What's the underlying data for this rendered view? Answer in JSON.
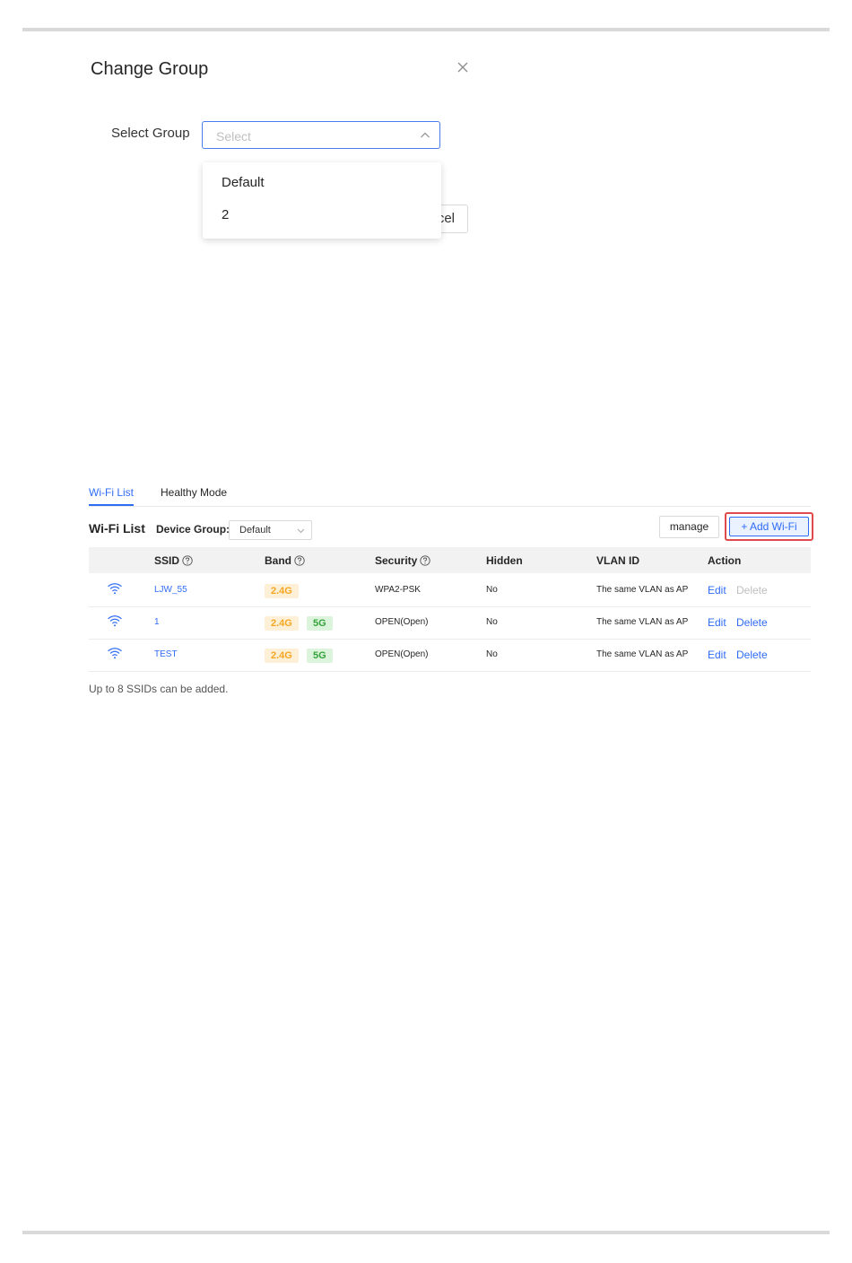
{
  "dialog": {
    "title": "Change Group",
    "select_label": "Select Group",
    "select_placeholder": "Select",
    "options": [
      "Default",
      "2"
    ],
    "cancel_label": "Cancel"
  },
  "tabs": [
    {
      "label": "Wi-Fi List",
      "active": true
    },
    {
      "label": "Healthy Mode",
      "active": false
    }
  ],
  "wifi_list": {
    "title": "Wi-Fi List",
    "device_group_label": "Device Group:",
    "device_group_value": "Default",
    "manage_label": "manage",
    "add_label": "+ Add Wi-Fi",
    "columns": [
      "SSID",
      "Band",
      "Security",
      "Hidden",
      "VLAN ID",
      "Action"
    ],
    "rows": [
      {
        "ssid": "LJW_55",
        "band24": "2.4G",
        "band5": "",
        "security": "WPA2-PSK",
        "hidden": "No",
        "vlan": "The same VLAN as AP",
        "edit": "Edit",
        "delete": "Delete",
        "delete_enabled": false
      },
      {
        "ssid": "1",
        "band24": "2.4G",
        "band5": "5G",
        "security": "OPEN(Open)",
        "hidden": "No",
        "vlan": "The same VLAN as AP",
        "edit": "Edit",
        "delete": "Delete",
        "delete_enabled": true
      },
      {
        "ssid": "TEST",
        "band24": "2.4G",
        "band5": "5G",
        "security": "OPEN(Open)",
        "hidden": "No",
        "vlan": "The same VLAN as AP",
        "edit": "Edit",
        "delete": "Delete",
        "delete_enabled": true
      }
    ],
    "note": "Up to 8 SSIDs can be added."
  },
  "colors": {
    "accent": "#2f6cf6",
    "highlight_border": "#e04a4a",
    "band24": "#f5a623",
    "band5": "#34a33a"
  }
}
